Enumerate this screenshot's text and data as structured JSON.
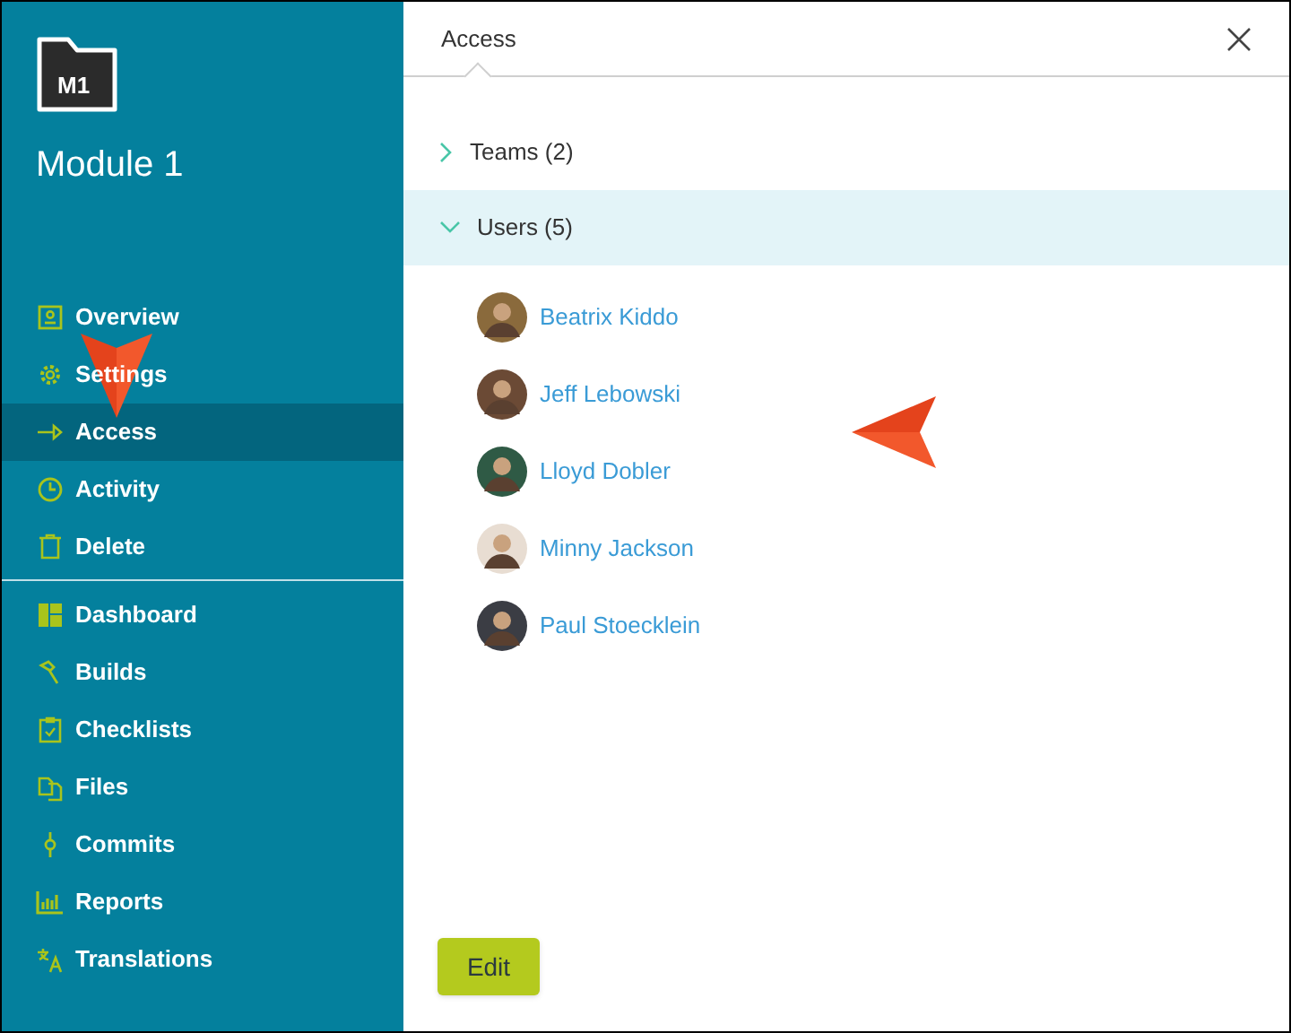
{
  "module": {
    "badge": "M1",
    "title": "Module 1"
  },
  "sidebar": {
    "groups": [
      {
        "items": [
          {
            "kind": "overview",
            "label": "Overview",
            "selected": false
          },
          {
            "kind": "settings",
            "label": "Settings",
            "selected": false
          },
          {
            "kind": "access",
            "label": "Access",
            "selected": true
          },
          {
            "kind": "activity",
            "label": "Activity",
            "selected": false
          },
          {
            "kind": "delete",
            "label": "Delete",
            "selected": false
          }
        ]
      },
      {
        "items": [
          {
            "kind": "dashboard",
            "label": "Dashboard",
            "selected": false
          },
          {
            "kind": "builds",
            "label": "Builds",
            "selected": false
          },
          {
            "kind": "checklists",
            "label": "Checklists",
            "selected": false
          },
          {
            "kind": "files",
            "label": "Files",
            "selected": false
          },
          {
            "kind": "commits",
            "label": "Commits",
            "selected": false
          },
          {
            "kind": "reports",
            "label": "Reports",
            "selected": false
          },
          {
            "kind": "translations",
            "label": "Translations",
            "selected": false
          }
        ]
      }
    ]
  },
  "panel": {
    "title": "Access",
    "sections": [
      {
        "label": "Teams (2)",
        "expanded": false
      },
      {
        "label": "Users (5)",
        "expanded": true,
        "members": [
          {
            "name": "Beatrix Kiddo"
          },
          {
            "name": "Jeff Lebowski"
          },
          {
            "name": "Lloyd Dobler"
          },
          {
            "name": "Minny Jackson"
          },
          {
            "name": "Paul Stoecklein"
          }
        ]
      }
    ],
    "button": "Edit"
  }
}
